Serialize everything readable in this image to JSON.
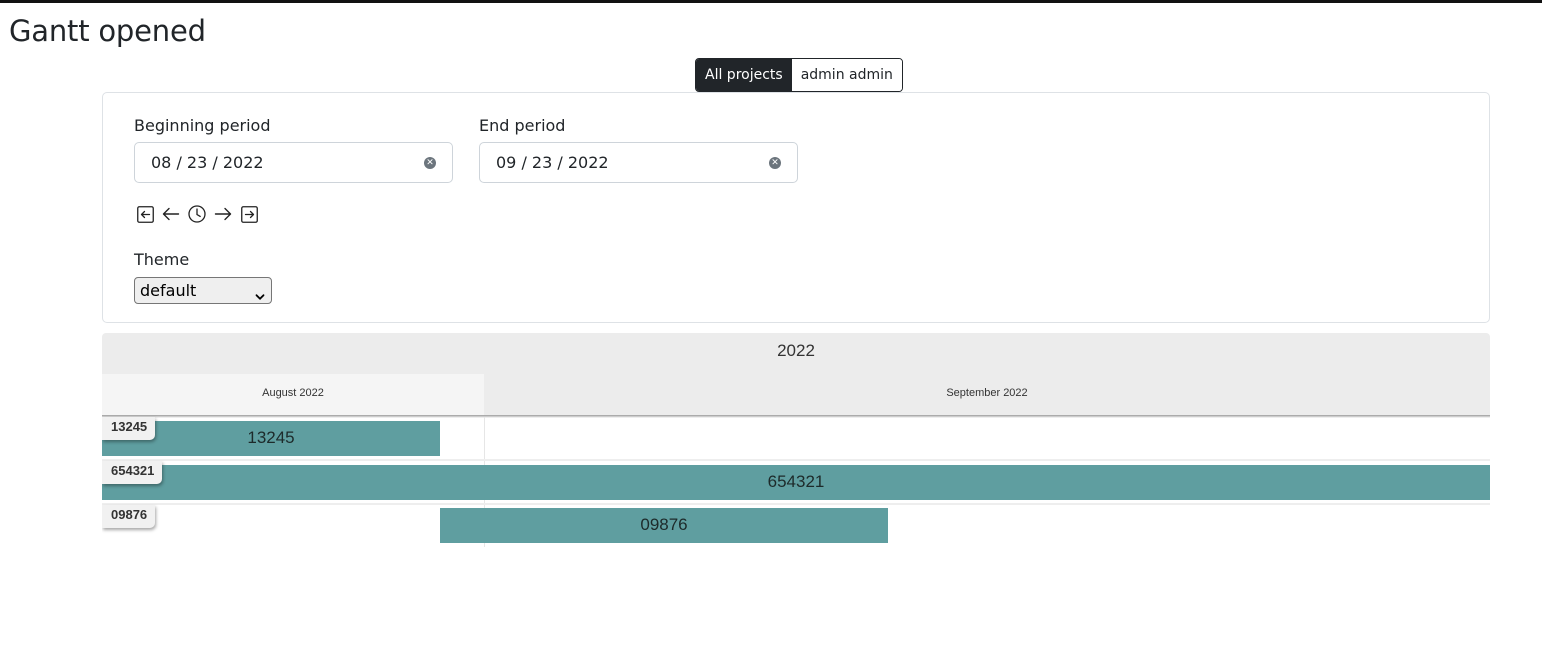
{
  "page": {
    "title": "Gantt opened"
  },
  "project_toggle": {
    "options": [
      "All projects",
      "admin admin"
    ],
    "active": "All projects"
  },
  "filters": {
    "beginning": {
      "label": "Beginning period",
      "value": "08 / 23 / 2022"
    },
    "end": {
      "label": "End period",
      "value": "09 / 23 / 2022"
    },
    "nav_icons": [
      "jump-to-start-icon",
      "previous-arrow-icon",
      "clock-icon",
      "next-arrow-icon",
      "jump-to-end-icon"
    ],
    "theme": {
      "label": "Theme",
      "selected": "default"
    }
  },
  "gantt": {
    "year": "2022",
    "months": [
      "August 2022",
      "September 2022"
    ],
    "rows": [
      {
        "label": "13245",
        "bar_text": "13245"
      },
      {
        "label": "654321",
        "bar_text": "654321"
      },
      {
        "label": "09876",
        "bar_text": "09876"
      }
    ],
    "bar_color": "#5f9ea0"
  }
}
